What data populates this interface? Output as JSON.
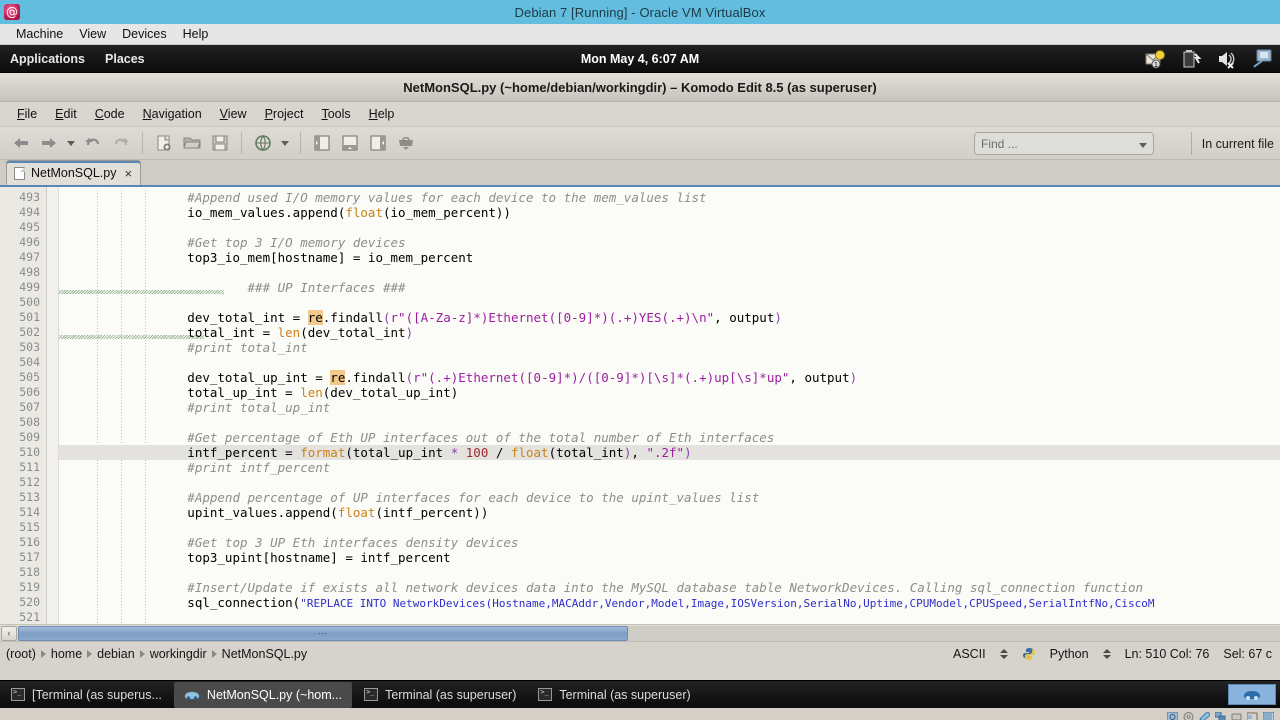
{
  "host_window": {
    "title": "Debian 7 [Running] - Oracle VM VirtualBox",
    "logo_icon": "virtualbox-logo-icon",
    "menu": [
      {
        "label": "Machine",
        "name": "machine"
      },
      {
        "label": "View",
        "name": "view"
      },
      {
        "label": "Devices",
        "name": "devices"
      },
      {
        "label": "Help",
        "name": "help"
      }
    ]
  },
  "gnome_top_panel": {
    "applications_label": "Applications",
    "places_label": "Places",
    "clock": "Mon May  4,  6:07 AM",
    "tray_icons": [
      "mail-notification-icon",
      "power-battery-icon",
      "volume-muted-icon",
      "network-display-icon"
    ]
  },
  "komodo": {
    "window_title": "NetMonSQL.py (~home/debian/workingdir) – Komodo Edit 8.5 (as superuser)",
    "menu": [
      {
        "label": "File",
        "mnemonic": "F"
      },
      {
        "label": "Edit",
        "mnemonic": "E"
      },
      {
        "label": "Code",
        "mnemonic": "C"
      },
      {
        "label": "Navigation",
        "mnemonic": "N"
      },
      {
        "label": "View",
        "mnemonic": "V"
      },
      {
        "label": "Project",
        "mnemonic": "P"
      },
      {
        "label": "Tools",
        "mnemonic": "T"
      },
      {
        "label": "Help",
        "mnemonic": "H"
      }
    ],
    "toolbar": {
      "icons": [
        "back-arrow-icon",
        "forward-arrow-icon",
        "history-dropdown-icon",
        "undo-icon",
        "redo-icon",
        "new-file-icon",
        "open-file-icon",
        "save-file-icon",
        "preview-browser-icon",
        "preview-dropdown-icon",
        "left-pane-icon",
        "bottom-pane-icon",
        "right-pane-icon",
        "toolbox-icon"
      ],
      "find_placeholder": "Find ...",
      "find_value": "",
      "find_scope_label": "In current file"
    },
    "tab": {
      "label": "NetMonSQL.py",
      "close_label": "×",
      "file_icon": "text-file-icon"
    },
    "editor": {
      "first_line": 493,
      "current_line": 510,
      "lines": [
        {
          "n": 493,
          "tokens": [
            {
              "t": "            #Append used I/O memory values for each device to the mem_values list",
              "c": "cmt"
            }
          ]
        },
        {
          "n": 494,
          "tokens": [
            {
              "t": "            io_mem_values.append("
            },
            {
              "t": "float",
              "c": "fn"
            },
            {
              "t": "(io_mem_percent))"
            }
          ]
        },
        {
          "n": 495,
          "tokens": [
            {
              "t": ""
            }
          ]
        },
        {
          "n": 496,
          "tokens": [
            {
              "t": "            #Get top 3 I/O memory devices",
              "c": "cmt"
            }
          ]
        },
        {
          "n": 497,
          "tokens": [
            {
              "t": "            top3_io_mem[hostname] = io_mem_percent"
            }
          ]
        },
        {
          "n": 498,
          "tokens": [
            {
              "t": ""
            }
          ]
        },
        {
          "n": 499,
          "tokens": [
            {
              "t": "                    ### UP Interfaces ###",
              "c": "cmt"
            }
          ]
        },
        {
          "n": 500,
          "tokens": [
            {
              "t": ""
            }
          ]
        },
        {
          "n": 501,
          "tokens": [
            {
              "t": "            dev_total_int = "
            },
            {
              "t": "re",
              "c": "kwhl"
            },
            {
              "t": ".findall"
            },
            {
              "t": "(",
              "c": "op"
            },
            {
              "t": "r\"([A-Za-z]*)Ethernet([0-9]*)(.+)YES(.+)\\n\"",
              "c": "str"
            },
            {
              "t": ", output"
            },
            {
              "t": ")",
              "c": "op"
            }
          ]
        },
        {
          "n": 502,
          "tokens": [
            {
              "t": "            total_int = "
            },
            {
              "t": "len",
              "c": "fn"
            },
            {
              "t": "(dev_total_int"
            },
            {
              "t": ")",
              "c": "op"
            }
          ]
        },
        {
          "n": 503,
          "tokens": [
            {
              "t": "            #print total_int",
              "c": "cmt"
            }
          ]
        },
        {
          "n": 504,
          "tokens": [
            {
              "t": ""
            }
          ]
        },
        {
          "n": 505,
          "tokens": [
            {
              "t": "            dev_total_up_int = "
            },
            {
              "t": "re",
              "c": "kwhl"
            },
            {
              "t": ".findall"
            },
            {
              "t": "(",
              "c": "op"
            },
            {
              "t": "r\"(.+)Ethernet([0-9]*)/([0-9]*)[\\s]*(.+)up[\\s]*up\"",
              "c": "str"
            },
            {
              "t": ", output"
            },
            {
              "t": ")",
              "c": "op"
            }
          ]
        },
        {
          "n": 506,
          "tokens": [
            {
              "t": "            total_up_int = "
            },
            {
              "t": "len",
              "c": "fn"
            },
            {
              "t": "(dev_total_up_int)"
            }
          ]
        },
        {
          "n": 507,
          "tokens": [
            {
              "t": "            #print total_up_int",
              "c": "cmt"
            }
          ]
        },
        {
          "n": 508,
          "tokens": [
            {
              "t": ""
            }
          ]
        },
        {
          "n": 509,
          "tokens": [
            {
              "t": "            #Get percentage of Eth UP interfaces out of the total number of Eth interfaces",
              "c": "cmt"
            }
          ]
        },
        {
          "n": 510,
          "current": true,
          "tokens": [
            {
              "t": "            intf_percent = "
            },
            {
              "t": "format",
              "c": "fn"
            },
            {
              "t": "(total_up_int "
            },
            {
              "t": "*",
              "c": "op"
            },
            {
              "t": " "
            },
            {
              "t": "100",
              "c": "num"
            },
            {
              "t": " / "
            },
            {
              "t": "float",
              "c": "fn"
            },
            {
              "t": "(total_int"
            },
            {
              "t": ")",
              "c": "op"
            },
            {
              "t": ", "
            },
            {
              "t": "\".2f\"",
              "c": "str"
            },
            {
              "t": ")",
              "c": "op"
            }
          ]
        },
        {
          "n": 511,
          "tokens": [
            {
              "t": "            #print intf_percent",
              "c": "cmt"
            }
          ]
        },
        {
          "n": 512,
          "tokens": [
            {
              "t": ""
            }
          ]
        },
        {
          "n": 513,
          "tokens": [
            {
              "t": "            #Append percentage of UP interfaces for each device to the upint_values list",
              "c": "cmt"
            }
          ]
        },
        {
          "n": 514,
          "tokens": [
            {
              "t": "            upint_values.append("
            },
            {
              "t": "float",
              "c": "fn"
            },
            {
              "t": "(intf_percent))"
            }
          ]
        },
        {
          "n": 515,
          "tokens": [
            {
              "t": ""
            }
          ]
        },
        {
          "n": 516,
          "tokens": [
            {
              "t": "            #Get top 3 UP Eth interfaces density devices",
              "c": "cmt"
            }
          ]
        },
        {
          "n": 517,
          "tokens": [
            {
              "t": "            top3_upint[hostname] = intf_percent"
            }
          ]
        },
        {
          "n": 518,
          "tokens": [
            {
              "t": ""
            }
          ]
        },
        {
          "n": 519,
          "tokens": [
            {
              "t": "            #Insert/Update if exists all network devices data into the MySQL database table NetworkDevices. Calling sql_connection function",
              "c": "cmt"
            }
          ]
        },
        {
          "n": 520,
          "tokens": [
            {
              "t": "            sql_connection("
            },
            {
              "t": "\"REPLACE INTO NetworkDevices(Hostname,MACAddr,Vendor,Model,Image,IOSVersion,SerialNo,Uptime,CPUModel,CPUSpeed,SerialIntfNo,CiscoM",
              "c": "sqlstr"
            }
          ]
        },
        {
          "n": 521,
          "tokens": [
            {
              "t": ""
            }
          ]
        }
      ]
    },
    "scrollbar": {
      "left_arrow": "‹",
      "thumb_grip": "⋯"
    },
    "statusbar": {
      "breadcrumbs": [
        "(root)",
        "home",
        "debian",
        "workingdir",
        "NetMonSQL.py"
      ],
      "encoding": "ASCII",
      "language": "Python",
      "language_icon": "python-icon",
      "position": "Ln: 510 Col: 76",
      "selection": "Sel: 67 c"
    }
  },
  "taskbar": {
    "tasks": [
      {
        "label": "[Terminal (as superus...",
        "icon": "terminal-icon",
        "active": false
      },
      {
        "label": "NetMonSQL.py (~hom...",
        "icon": "komodo-icon",
        "active": true
      },
      {
        "label": "Terminal (as superuser)",
        "icon": "terminal-icon",
        "active": false
      },
      {
        "label": "Terminal (as superuser)",
        "icon": "terminal-icon",
        "active": false
      }
    ],
    "workspace_switcher_icon": "komodo-icon"
  },
  "vbox_status_icons": [
    "hard-disk-icon",
    "optical-disk-icon",
    "floppy-disk-icon",
    "network-icon",
    "usb-icon",
    "shared-folder-icon",
    "display-icon"
  ],
  "colors": {
    "vbox_titlebar": "#62bdde",
    "komodo_chrome": "#d6d3cd",
    "editor_bg": "#fbfbf8",
    "tab_accent": "#5a87b8",
    "comment": "#8d8d8d",
    "string": "#9b1fa0",
    "function": "#c8821a",
    "number": "#9c2b2b",
    "sql_string": "#2e2ec8"
  }
}
